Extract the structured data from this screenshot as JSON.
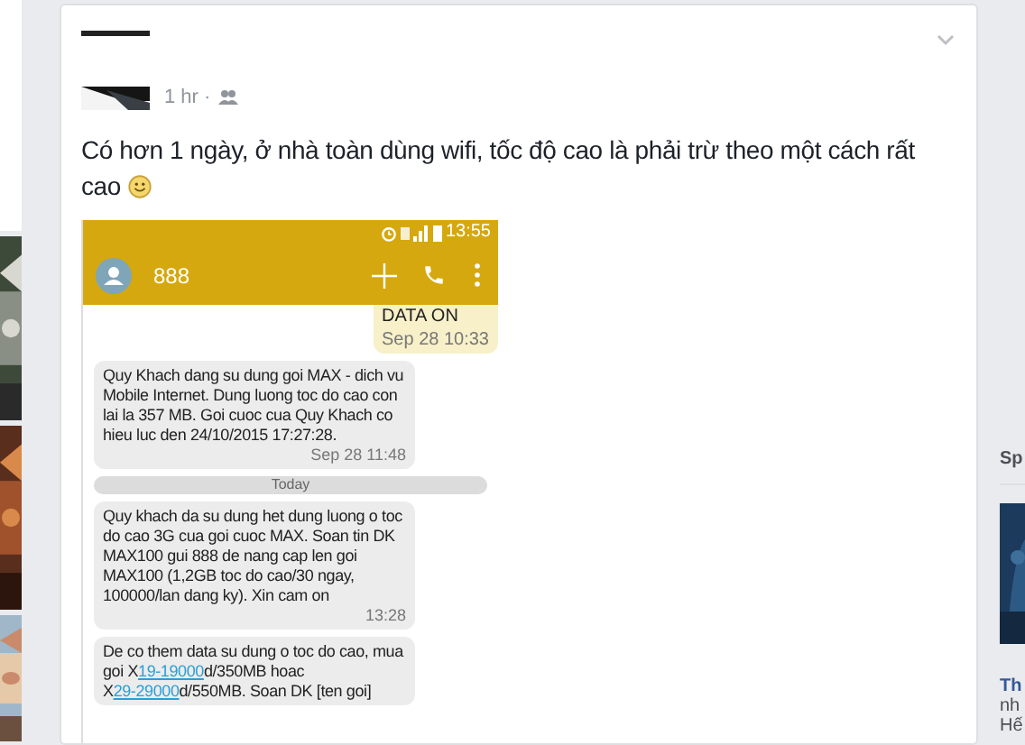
{
  "post": {
    "time": "1 hr ·",
    "text": "Có hơn 1 ngày, ở nhà toàn dùng wifi, tốc độ cao là phải trừ theo một cách rất cao",
    "phone": {
      "status_time": "13:55",
      "contact": "888",
      "messages": [
        {
          "kind": "sent",
          "text": "DATA ON",
          "time": "Sep 28 10:33"
        },
        {
          "kind": "received",
          "parts": [
            {
              "kind": "text",
              "text": "Quy Khach dang su dung goi MAX - dich vu Mobile Internet. Dung luong toc do cao con lai la 357 MB. Goi cuoc cua Quy Khach co hieu luc den 24/10/2015 17:27:28."
            }
          ],
          "time": "Sep 28 11:48"
        },
        {
          "kind": "divider",
          "time": "Today"
        },
        {
          "kind": "received",
          "parts": [
            {
              "kind": "text",
              "text": "Quy khach da su dung het dung luong o toc do cao 3G cua goi cuoc MAX. Soan tin DK MAX100 gui 888 de nang cap len goi MAX100 (1,2GB toc do cao/30 ngay, 100000/lan dang ky). Xin cam on"
            }
          ],
          "time": "13:28"
        },
        {
          "kind": "received",
          "parts": [
            {
              "kind": "text",
              "text": "De co them data su dung o toc do cao, mua goi X"
            },
            {
              "kind": "link",
              "text": "19-19000"
            },
            {
              "kind": "text",
              "text": "d/350MB hoac X"
            },
            {
              "kind": "link",
              "text": "29-29000"
            },
            {
              "kind": "text",
              "text": "d/550MB. Soan DK [ten goi]"
            }
          ]
        }
      ]
    }
  },
  "sidebar": {
    "heading": "Sp",
    "ad": {
      "title": "Th",
      "lines": [
        "nh",
        "Hế"
      ]
    }
  }
}
